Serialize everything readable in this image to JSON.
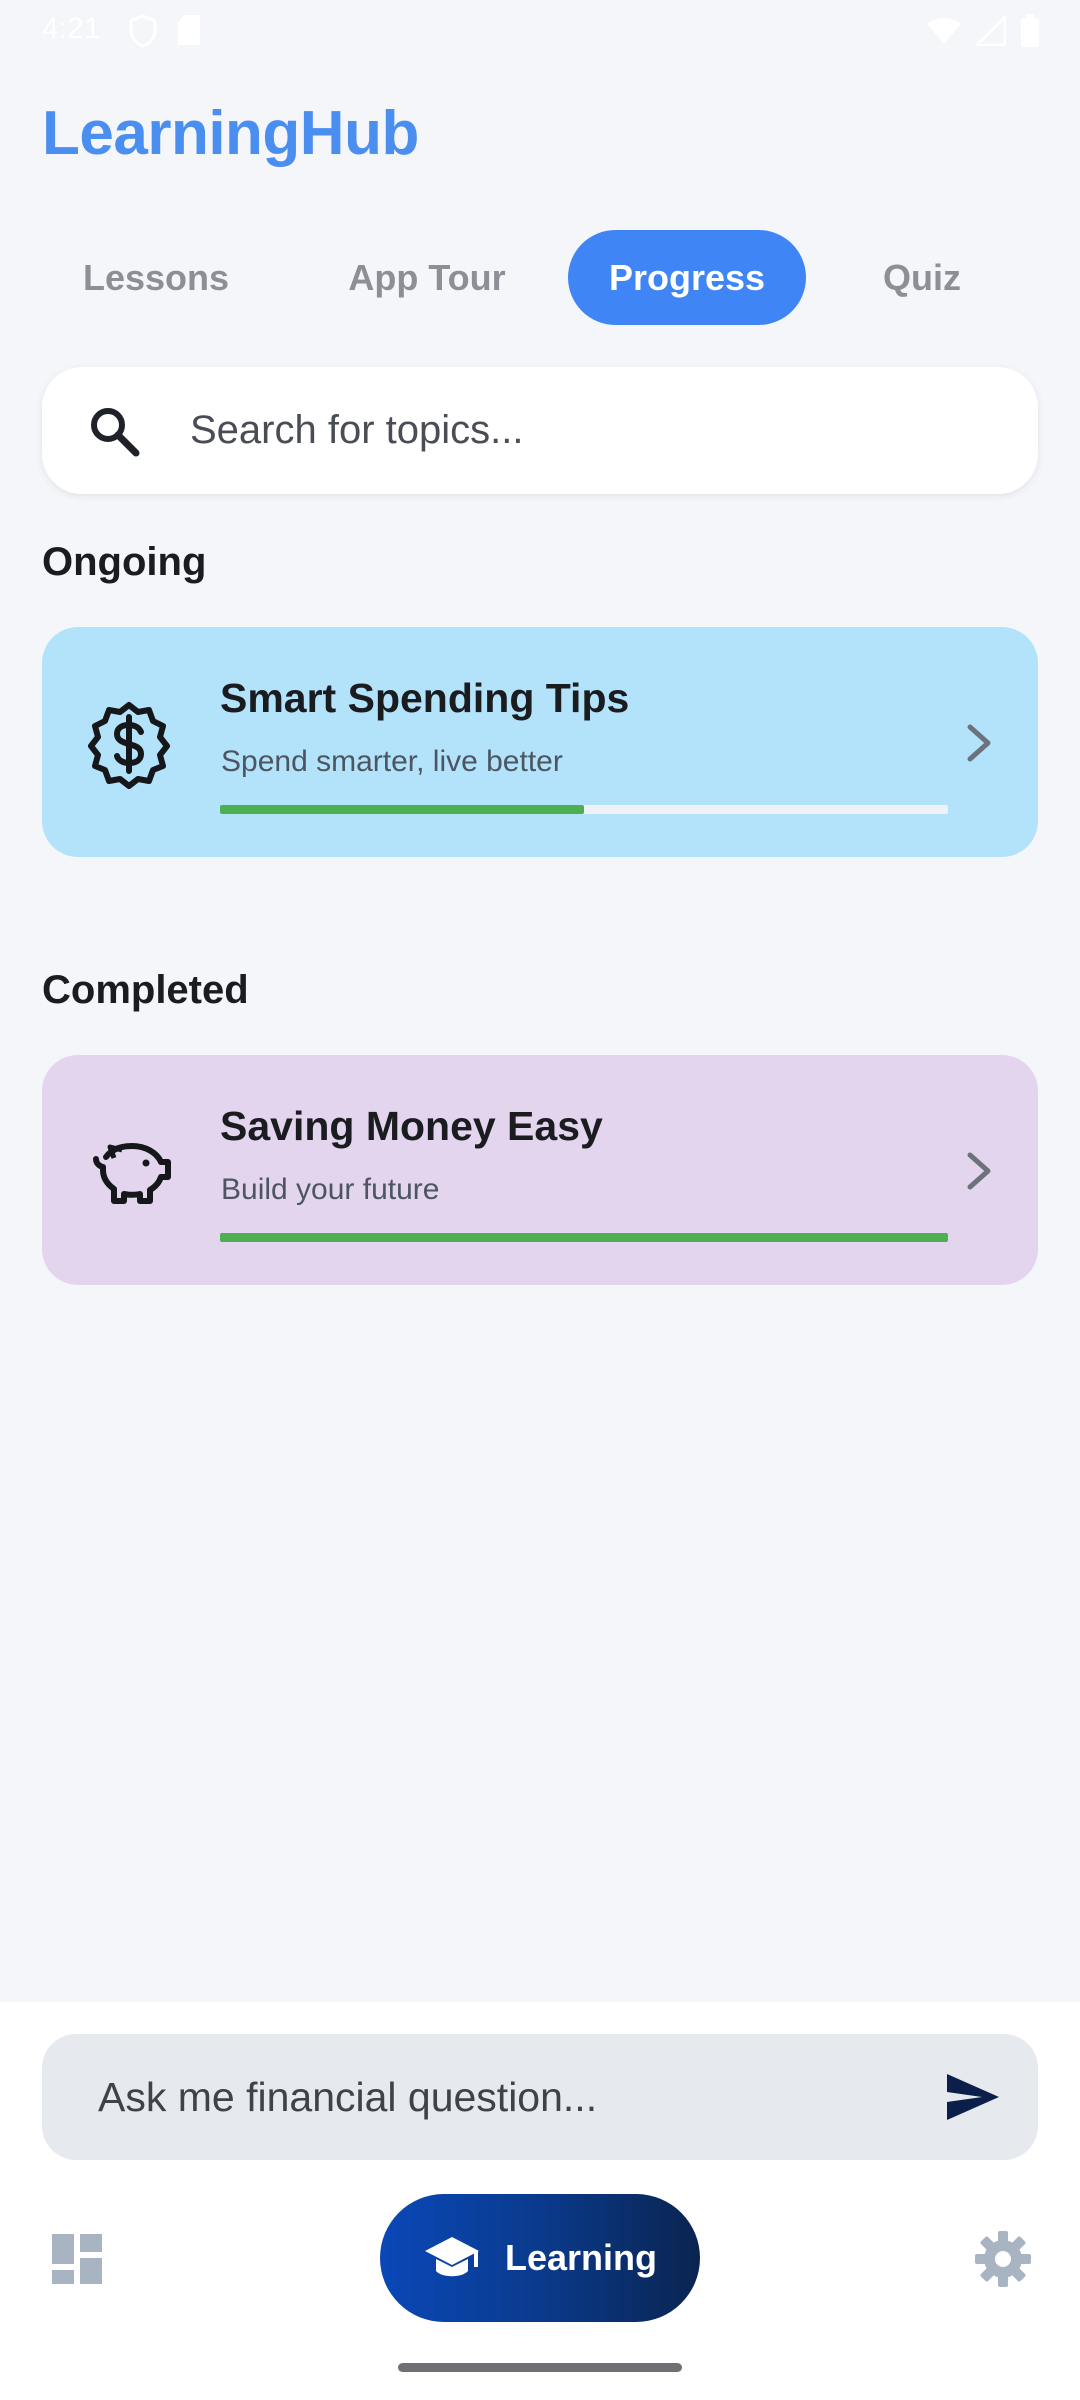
{
  "status_bar": {
    "time": "4:21"
  },
  "app": {
    "title": "LearningHub"
  },
  "tabs": [
    {
      "label": "Lessons",
      "active": false
    },
    {
      "label": "App Tour",
      "active": false
    },
    {
      "label": "Progress",
      "active": true
    },
    {
      "label": "Quiz",
      "active": false
    }
  ],
  "search": {
    "placeholder": "Search for topics...",
    "value": ""
  },
  "sections": {
    "ongoing": {
      "title": "Ongoing",
      "items": [
        {
          "title": "Smart Spending Tips",
          "subtitle": "Spend smarter, live better",
          "icon": "dollar-badge-icon",
          "progress_fraction": 0.5,
          "bg_color": "#b2e3fa"
        }
      ]
    },
    "completed": {
      "title": "Completed",
      "items": [
        {
          "title": "Saving Money Easy",
          "subtitle": "Build your future",
          "icon": "piggy-bank-icon",
          "progress_fraction": 1.0,
          "bg_color": "#e3d5ee"
        }
      ]
    }
  },
  "ask": {
    "placeholder": "Ask me financial question...",
    "value": ""
  },
  "bottom_nav": {
    "dashboard_icon": "dashboard-icon",
    "learning": {
      "label": "Learning",
      "icon": "graduation-cap-icon"
    },
    "settings_icon": "gear-icon"
  },
  "colors": {
    "accent": "#3f85f5",
    "title": "#4a8ef0",
    "progress": "#4caf50",
    "nav_gradient_start": "#0a48b8",
    "nav_gradient_end": "#0a2450"
  }
}
